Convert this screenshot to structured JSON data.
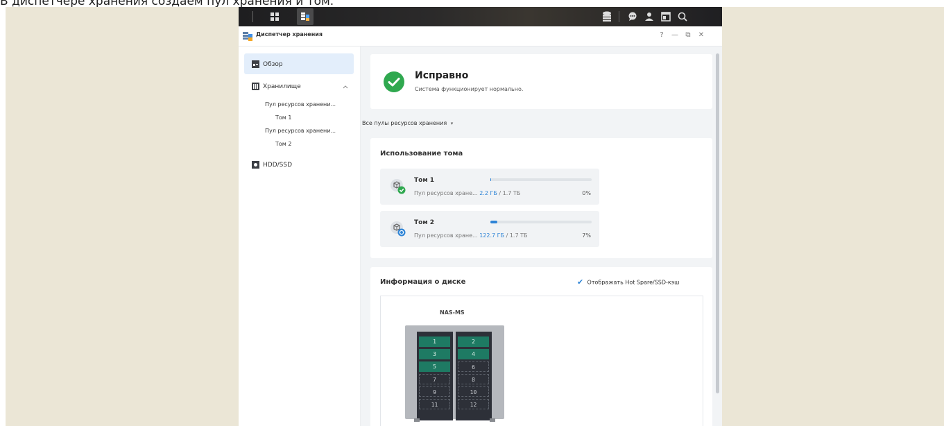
{
  "caption": "В диспетчере хранения создаем пул хранения и том.",
  "window": {
    "title": "Диспетчер хранения",
    "controls": {
      "help": "?",
      "minimize": "—",
      "maximize": "⧉",
      "close": "✕"
    }
  },
  "sidebar": {
    "items": [
      {
        "label": "Обзор",
        "icon": "overview-icon",
        "selected": true
      },
      {
        "label": "Хранилище",
        "icon": "storage-icon",
        "expanded": true
      },
      {
        "label": "Пул ресурсов хранени..."
      },
      {
        "label": "Том 1"
      },
      {
        "label": "Пул ресурсов хранени..."
      },
      {
        "label": "Том 2"
      },
      {
        "label": "HDD/SSD",
        "icon": "hdd-icon"
      }
    ]
  },
  "status": {
    "title": "Исправно",
    "subtitle": "Система функционирует нормально."
  },
  "pools_filter": "Все пулы ресурсов хранения",
  "volume_usage": {
    "title": "Использование тома",
    "volumes": [
      {
        "name": "Том 1",
        "pool": "Пул ресурсов хране...",
        "used": "2.2 ГБ",
        "total": "1.7 ТБ",
        "percent_label": "0%",
        "percent": 0.01,
        "status": "ok"
      },
      {
        "name": "Том 2",
        "pool": "Пул ресурсов хране...",
        "used": "122.7 ГБ",
        "total": "1.7 ТБ",
        "percent_label": "7%",
        "percent": 0.07,
        "status": "syncing"
      }
    ]
  },
  "disk_info": {
    "title": "Информация о диске",
    "show_hot_spare_label": "Отображать Hot Spare/SSD-кэш",
    "show_hot_spare_checked": true,
    "nas_name": "NAS-MS",
    "slots": [
      {
        "n": "1",
        "active": true
      },
      {
        "n": "2",
        "active": true
      },
      {
        "n": "3",
        "active": true
      },
      {
        "n": "4",
        "active": true
      },
      {
        "n": "5",
        "active": true
      },
      {
        "n": "6",
        "active": false
      },
      {
        "n": "7",
        "active": false
      },
      {
        "n": "8",
        "active": false
      },
      {
        "n": "9",
        "active": false
      },
      {
        "n": "10",
        "active": false
      },
      {
        "n": "11",
        "active": false
      },
      {
        "n": "12",
        "active": false
      }
    ]
  },
  "colors": {
    "accent": "#2e84d6",
    "ok": "#2fa84f",
    "disk_active": "#1e7a63"
  }
}
